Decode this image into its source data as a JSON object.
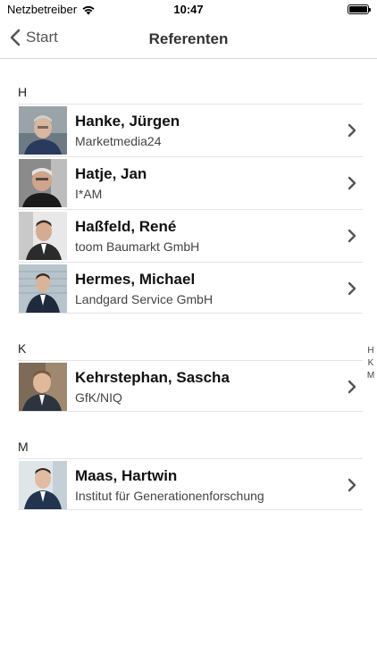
{
  "status_bar": {
    "carrier": "Netzbetreiber",
    "time": "10:47"
  },
  "nav": {
    "back_label": "Start",
    "title": "Referenten"
  },
  "sections": [
    {
      "letter": "H",
      "items": [
        {
          "name": "Hanke, Jürgen",
          "subtitle": "Marketmedia24"
        },
        {
          "name": "Hatje, Jan",
          "subtitle": "I*AM"
        },
        {
          "name": "Haßfeld, René",
          "subtitle": "toom Baumarkt GmbH"
        },
        {
          "name": "Hermes, Michael",
          "subtitle": "Landgard Service GmbH"
        }
      ]
    },
    {
      "letter": "K",
      "items": [
        {
          "name": "Kehrstephan, Sascha",
          "subtitle": "GfK/NIQ"
        }
      ]
    },
    {
      "letter": "M",
      "items": [
        {
          "name": "Maas, Hartwin",
          "subtitle": "Institut für Generationenforschung"
        }
      ]
    }
  ],
  "index": [
    "H",
    "K",
    "M"
  ]
}
